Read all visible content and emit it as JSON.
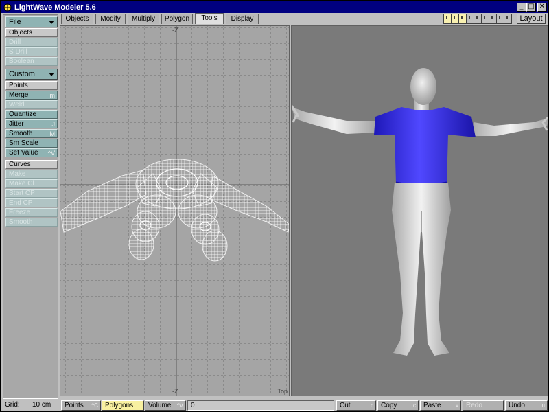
{
  "window": {
    "title": "LightWave Modeler 5.6",
    "min_glyph": "_",
    "max_glyph": "□",
    "close_glyph": "✕"
  },
  "tabs": [
    {
      "label": "Objects"
    },
    {
      "label": "Modify"
    },
    {
      "label": "Multiply"
    },
    {
      "label": "Polygon"
    },
    {
      "label": "Tools",
      "active": true
    },
    {
      "label": "Display"
    }
  ],
  "layout_button": "Layout",
  "left_panel": {
    "file_menu": "File",
    "objects_header": "Objects",
    "objects_items": [
      {
        "label": "Drill",
        "enabled": false
      },
      {
        "label": "S Drill",
        "enabled": false
      },
      {
        "label": "Boolean",
        "enabled": false
      }
    ],
    "custom_menu": "Custom",
    "points_header": "Points",
    "points_items": [
      {
        "label": "Merge",
        "key": "m",
        "enabled": true
      },
      {
        "label": "Weld",
        "key": "",
        "enabled": false
      },
      {
        "label": "Quantize",
        "key": "",
        "enabled": true
      },
      {
        "label": "Jitter",
        "key": "J",
        "enabled": true
      },
      {
        "label": "Smooth",
        "key": "M",
        "enabled": true
      },
      {
        "label": "Sm Scale",
        "key": "",
        "enabled": true
      },
      {
        "label": "Set Value",
        "key": "^V",
        "enabled": true
      }
    ],
    "curves_header": "Curves",
    "curves_items": [
      {
        "label": "Make",
        "enabled": false
      },
      {
        "label": "Make Cl",
        "enabled": false
      },
      {
        "label": "Start CP",
        "enabled": false
      },
      {
        "label": "End CP",
        "enabled": false
      },
      {
        "label": "Freeze",
        "enabled": false
      },
      {
        "label": "Smooth",
        "enabled": false
      }
    ]
  },
  "viewport_top": {
    "axis_top": "-Z",
    "axis_bottom": "-Z",
    "view_name": "Top"
  },
  "status_bar": {
    "grid_label": "Grid:",
    "grid_value": "10 cm",
    "modes": [
      {
        "label": "Points",
        "key": "^C",
        "selected": false
      },
      {
        "label": "Polygons",
        "key": "",
        "selected": true
      },
      {
        "label": "Volume",
        "key": "^V",
        "selected": false
      }
    ],
    "count": "0",
    "edit_buttons": [
      {
        "label": "Cut",
        "key": "c",
        "enabled": true
      },
      {
        "label": "Copy",
        "key": "c",
        "enabled": true
      },
      {
        "label": "Paste",
        "key": "v",
        "enabled": true
      },
      {
        "label": "Redo",
        "key": "",
        "enabled": false
      },
      {
        "label": "Undo",
        "key": "u",
        "enabled": true
      }
    ]
  },
  "colors": {
    "shirt": "#3a32e6",
    "skin": "#d8d8d8",
    "viewport_bg": "#7a7a7a",
    "grid_bg": "#a5a5a5",
    "title_bar": "#000080"
  },
  "icons": {
    "app": "lightwave-icon"
  }
}
